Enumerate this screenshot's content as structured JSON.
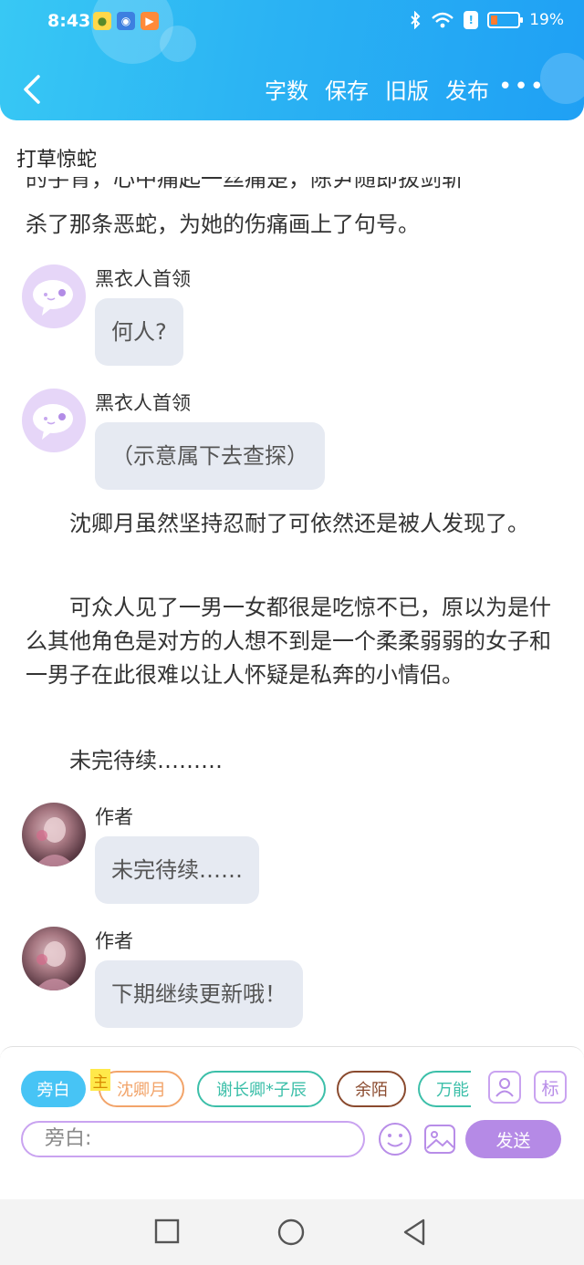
{
  "status": {
    "time": "8:43",
    "battery": "19%",
    "battery_level": 0.19
  },
  "nav": {
    "actions": [
      "字数",
      "保存",
      "旧版",
      "发布"
    ],
    "more": "•••"
  },
  "chapter_title": "打草惊蛇",
  "content": {
    "partial_line_top": "的手背，心中痛起一丝痛楚，陈尹随即拔剑斩",
    "paragraph1_end": "杀了那条恶蛇，为她的伤痛画上了句号。",
    "messages": [
      {
        "speaker": "黑衣人首领",
        "text": "何人?"
      },
      {
        "speaker": "黑衣人首领",
        "text": "（示意属下去查探）"
      },
      {
        "speaker": "作者",
        "text": "未完待续……"
      },
      {
        "speaker": "作者",
        "text": "下期继续更新哦！"
      }
    ],
    "paragraph2": "　　沈卿月虽然坚持忍耐了可依然还是被人发现了。",
    "paragraph3": "　　可众人见了一男一女都很是吃惊不已，原以为是什么其他角色是对方的人想不到是一个柔柔弱弱的女子和一男子在此很难以让人怀疑是私奔的小情侣。",
    "paragraph4": "　　未完待续………"
  },
  "panel": {
    "chips": [
      "旁白",
      "沈卿月",
      "谢长卿*子辰",
      "余陌",
      "万能"
    ],
    "host_tag": "主",
    "mark_icon_label": "标",
    "input_placeholder": "旁白:",
    "send_label": "发送",
    "colors": {
      "accent_blue": "#47c4f5",
      "chip_orange": "#f2a46a",
      "chip_teal": "#3cbfa9",
      "chip_brown": "#8a4a2e",
      "purple": "#b58ae6"
    }
  }
}
